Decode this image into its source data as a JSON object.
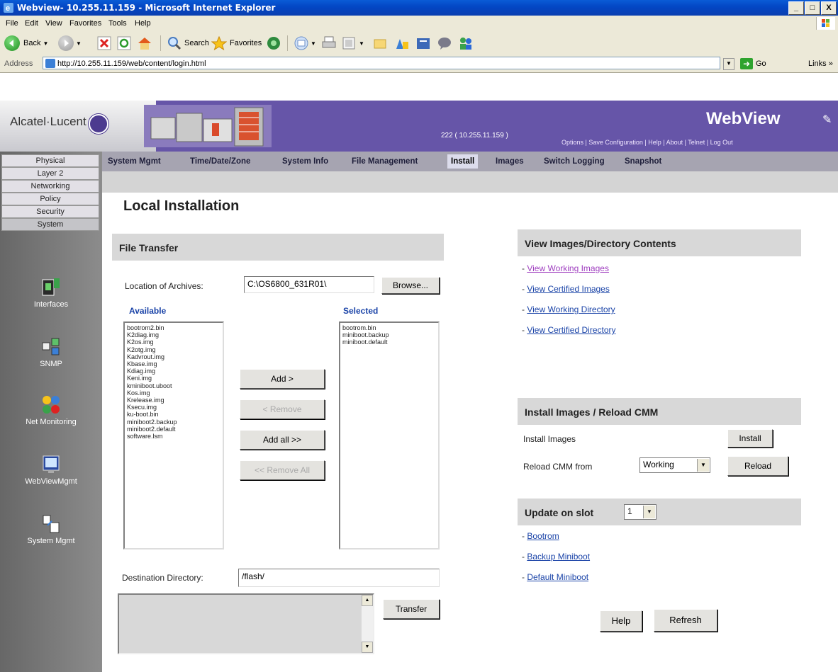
{
  "window": {
    "title": "Webview- 10.255.11.159 - Microsoft Internet Explorer",
    "controls": [
      "_",
      "□",
      "X"
    ]
  },
  "menu": [
    "File",
    "Edit",
    "View",
    "Favorites",
    "Tools",
    "Help"
  ],
  "toolbar": {
    "back": "Back",
    "search": "Search",
    "favorites": "Favorites"
  },
  "address": {
    "label": "Address",
    "url": "http://10.255.11.159/web/content/login.html",
    "go": "Go",
    "links": "Links »"
  },
  "header": {
    "brand": "Alcatel·Lucent",
    "device": "222  ( 10.255.11.159 )",
    "product": "WebView",
    "links": "Options  |  Save Configuration | Help | About | Telnet | Log Out"
  },
  "leftnav": {
    "tabs": [
      "Physical",
      "Layer 2",
      "Networking",
      "Policy",
      "Security",
      "System"
    ],
    "icons": [
      "Interfaces",
      "SNMP",
      "Net Monitoring",
      "WebViewMgmt",
      "System Mgmt"
    ]
  },
  "subnav": [
    "System Mgmt",
    "Time/Date/Zone",
    "System Info",
    "File Management",
    "Install",
    "Images",
    "Switch Logging",
    "Snapshot"
  ],
  "page": {
    "title": "Local Installation",
    "file_transfer": {
      "heading": "File Transfer",
      "location_label": "Location of Archives:",
      "location_value": "C:\\OS6800_631R01\\",
      "browse": "Browse...",
      "available_label": "Available",
      "selected_label": "Selected",
      "available": [
        "bootrom2.bin",
        "K2diag.img",
        "K2os.img",
        "K2otg.img",
        "Kadvrout.img",
        "Kbase.img",
        "Kdiag.img",
        "Keni.img",
        "kminiboot.uboot",
        "Kos.img",
        "Krelease.img",
        "Ksecu.img",
        "ku-boot.bin",
        "miniboot2.backup",
        "miniboot2.default",
        "software.lsm"
      ],
      "selected": [
        "bootrom.bin",
        "miniboot.backup",
        "miniboot.default"
      ],
      "add": "Add >",
      "remove": "< Remove",
      "add_all": "Add all >>",
      "remove_all": "<< Remove All",
      "dest_label": "Destination Directory:",
      "dest_value": "/flash/",
      "transfer": "Transfer"
    },
    "view_images": {
      "heading": "View Images/Directory Contents",
      "links": [
        "View Working Images",
        "View Certified Images",
        "View Working Directory",
        "View Certified Directory"
      ]
    },
    "install": {
      "heading": "Install Images / Reload CMM",
      "install_label": "Install Images",
      "install_btn": "Install",
      "reload_label": "Reload CMM from",
      "reload_select": "Working",
      "reload_btn": "Reload"
    },
    "update": {
      "heading": "Update on slot",
      "slot": "1",
      "links": [
        "Bootrom",
        "Backup Miniboot",
        "Default Miniboot"
      ]
    },
    "help": "Help",
    "refresh": "Refresh"
  }
}
